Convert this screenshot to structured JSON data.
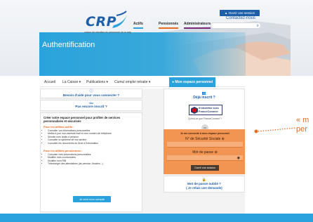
{
  "brand": {
    "logo_text": "CRP",
    "tagline": "caisse de retraites du personnel de la ratp",
    "color_primary": "#1d5fa8",
    "color_accent": "#2aa3dc",
    "color_orange": "#f29452"
  },
  "header": {
    "page_title": "Authentification",
    "open_session_label": "▲ Ouvrir une session",
    "contact_label": "Contactez-nous",
    "audience_tabs": [
      {
        "label": "Actifs",
        "color": "#2aa3dc"
      },
      {
        "label": "Pensionnés",
        "color": "#e86b1f"
      },
      {
        "label": "Administrateurs",
        "color": "#7a2a7a"
      }
    ],
    "search_icon": "search-icon"
  },
  "navbar": {
    "items": [
      "Accueil",
      "La Caisse ▾",
      "Publications ▾",
      "Cumul emploi retraite ▾"
    ],
    "active_label": "● Mon espace personnel"
  },
  "help": {
    "icon": "help-icon",
    "label": "Besoin d'aide pour vous connecter ?"
  },
  "not_registered": {
    "or": "Ou",
    "label": "Pas encore inscrit ?"
  },
  "left_panel": {
    "heading": "Créer votre espace personnel pour profiter de services personnalisés et sécurisés",
    "active_title": "Pour les affiliés actifs :",
    "active_items": [
      "Consulter vos informations personnelles",
      "Mettre à jour mon adresse mail et mon numéro de téléphone",
      "Simuler mes droits à pension",
      "Consulter la synthèse de ma carrière",
      "Consulter les documents du Droit à l'information"
    ],
    "pensioner_title": "Pour les affiliés pensionnés :",
    "pensioner_items": [
      "Consulter mes informations personnelles",
      "Modifier mes coordonnées",
      "Modifier mon RIB",
      "Télécharger des attestations (de pension, fiscales...)"
    ],
    "create_button": "Je crée mon compte"
  },
  "already": {
    "icon": "users-icon",
    "label": "Déjà inscrit ?",
    "fc_line1": "S'identifier avec",
    "fc_line2": "FranceConnect",
    "fc_what": "Qu'est-ce que FranceConnect ?",
    "or": "ou"
  },
  "login": {
    "title": "Je me connecte à mon espace personnel",
    "ssn_label": "N° de Sécurité Sociale ⊕",
    "password_label": "Mot de passe ⊕",
    "submit": "Ouvrir une session"
  },
  "forgot": {
    "icon": "lock-icon",
    "line1": "Mot de passe oublié ?",
    "line2": "( Je refais une demande)"
  },
  "callout": {
    "text_line1": "« m",
    "text_line2": "per"
  }
}
